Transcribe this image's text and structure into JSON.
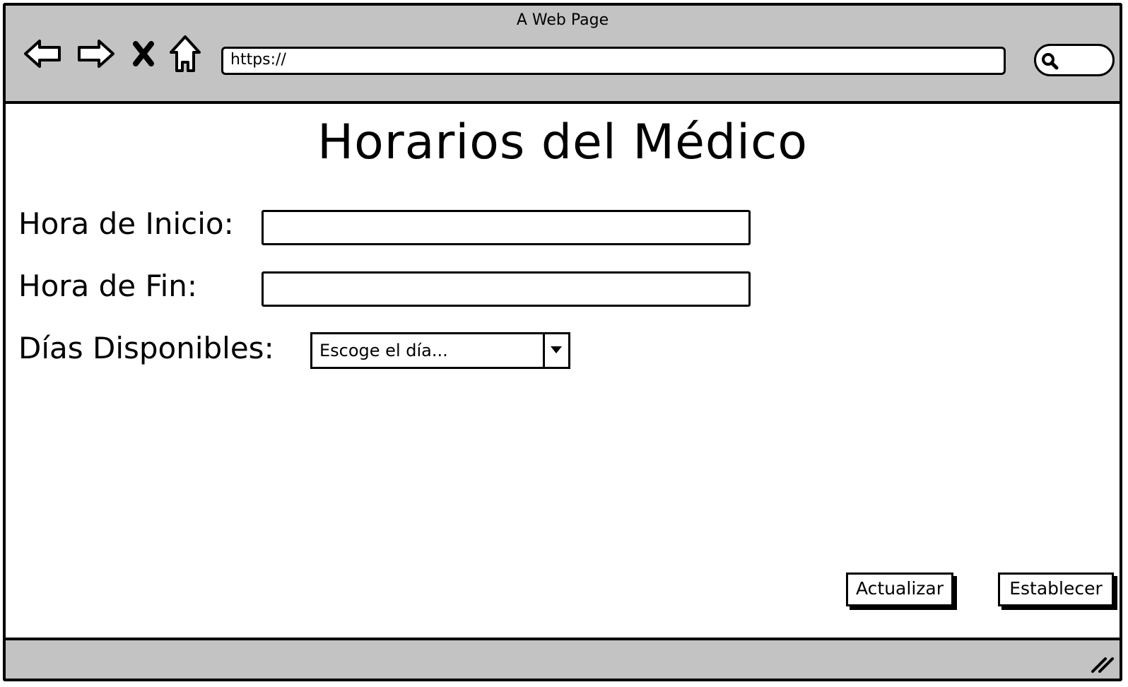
{
  "window": {
    "title": "A Web Page",
    "url": "https://"
  },
  "toolbar": {
    "icons": [
      "back-arrow-icon",
      "forward-arrow-icon",
      "stop-icon",
      "home-icon",
      "search-icon"
    ]
  },
  "page": {
    "title": "Horarios del Médico",
    "fields": {
      "start_label": "Hora de Inicio:",
      "start_value": "",
      "end_label": "Hora de Fin:",
      "end_value": "",
      "days_label": "Días Disponibles:",
      "days_selected": "Escoge el día..."
    },
    "buttons": {
      "update": "Actualizar",
      "set": "Establecer"
    }
  },
  "colors": {
    "chrome": "#c3c3c3",
    "stroke": "#000000",
    "background": "#ffffff"
  }
}
